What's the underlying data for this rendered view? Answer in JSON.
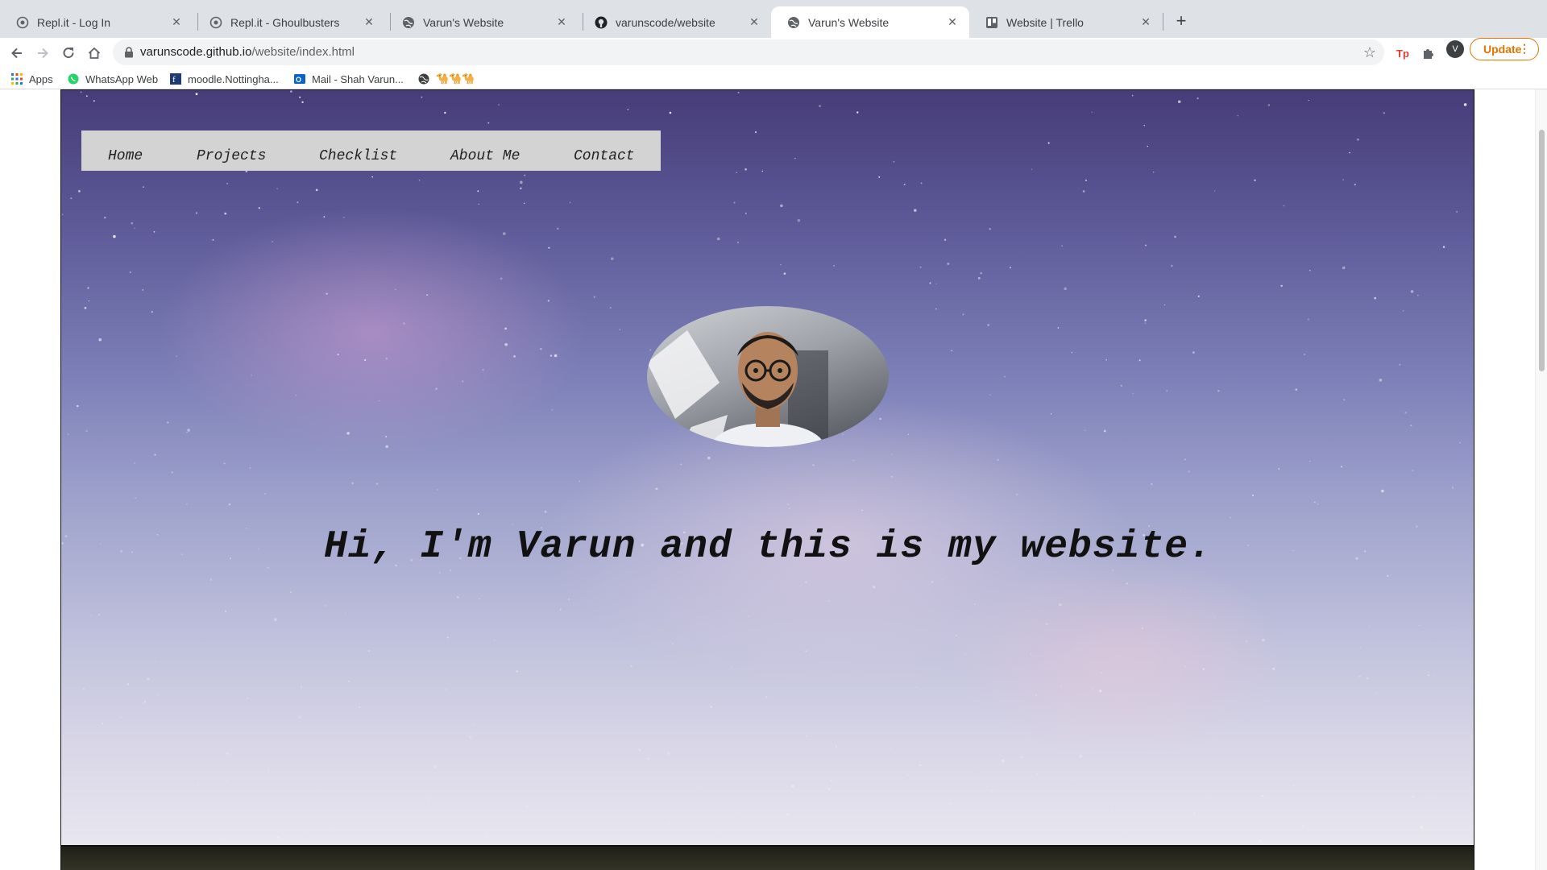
{
  "tabs": [
    {
      "title": "Repl.it - Log In",
      "icon": "replit-icon"
    },
    {
      "title": "Repl.it - Ghoulbusters",
      "icon": "replit-icon"
    },
    {
      "title": "Varun's Website",
      "icon": "globe-icon"
    },
    {
      "title": "varunscode/website",
      "icon": "github-icon"
    },
    {
      "title": "Varun's Website",
      "icon": "globe-icon",
      "active": true
    },
    {
      "title": "Website | Trello",
      "icon": "trello-icon"
    }
  ],
  "address_bar": {
    "host": "varunscode.github.io",
    "path": "/website/index.html"
  },
  "profile": {
    "initial": "V"
  },
  "update_button": {
    "label": "Update"
  },
  "bookmarks": [
    {
      "label": "Apps",
      "icon": "apps-grid-icon"
    },
    {
      "label": "WhatsApp Web",
      "icon": "whatsapp-icon"
    },
    {
      "label": "moodle.Nottingha...",
      "icon": "moodle-icon"
    },
    {
      "label": "Mail - Shah Varun...",
      "icon": "outlook-icon"
    },
    {
      "label": "🐪🐪🐪",
      "icon": "globe-icon"
    }
  ],
  "site": {
    "nav": [
      "Home",
      "Projects",
      "Checklist",
      "About Me",
      "Contact"
    ],
    "headline": "Hi, I'm Varun and this is my website."
  },
  "colors": {
    "tabstrip": "#dee1e6",
    "update_accent": "#e37400",
    "nav_background": "#d3d3d3"
  }
}
